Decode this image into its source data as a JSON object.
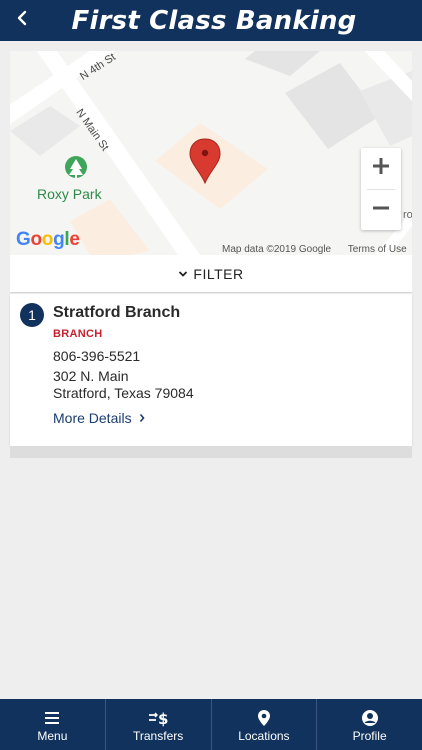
{
  "header": {
    "title": "First Class Banking",
    "back_icon": "chevron-left-icon"
  },
  "map": {
    "streets": [
      "N 4th St",
      "N Main St"
    ],
    "park": "Roxy Park",
    "google_logo": "Google",
    "footer": [
      "Map data ©2019 Google",
      "Terms of Use"
    ],
    "edge_text": "ro",
    "zoom_in": "+",
    "zoom_out": "−",
    "pin_color": "#d93a30"
  },
  "filter": {
    "label": "FILTER",
    "icon": "chevron-down-icon"
  },
  "locations": [
    {
      "number": "1",
      "name": "Stratford Branch",
      "type": "BRANCH",
      "phone": "806-396-5521",
      "address_line1": "302 N. Main",
      "address_line2": "Stratford, Texas 79084",
      "more": "More Details"
    }
  ],
  "nav": {
    "items": [
      {
        "label": "Menu",
        "icon": "menu-icon"
      },
      {
        "label": "Transfers",
        "icon": "transfers-icon"
      },
      {
        "label": "Locations",
        "icon": "location-pin-icon"
      },
      {
        "label": "Profile",
        "icon": "profile-icon"
      }
    ]
  },
  "colors": {
    "brand": "#11325c",
    "accent_red": "#c4212e",
    "link": "#1b3d6e",
    "background": "#eeeeee"
  }
}
